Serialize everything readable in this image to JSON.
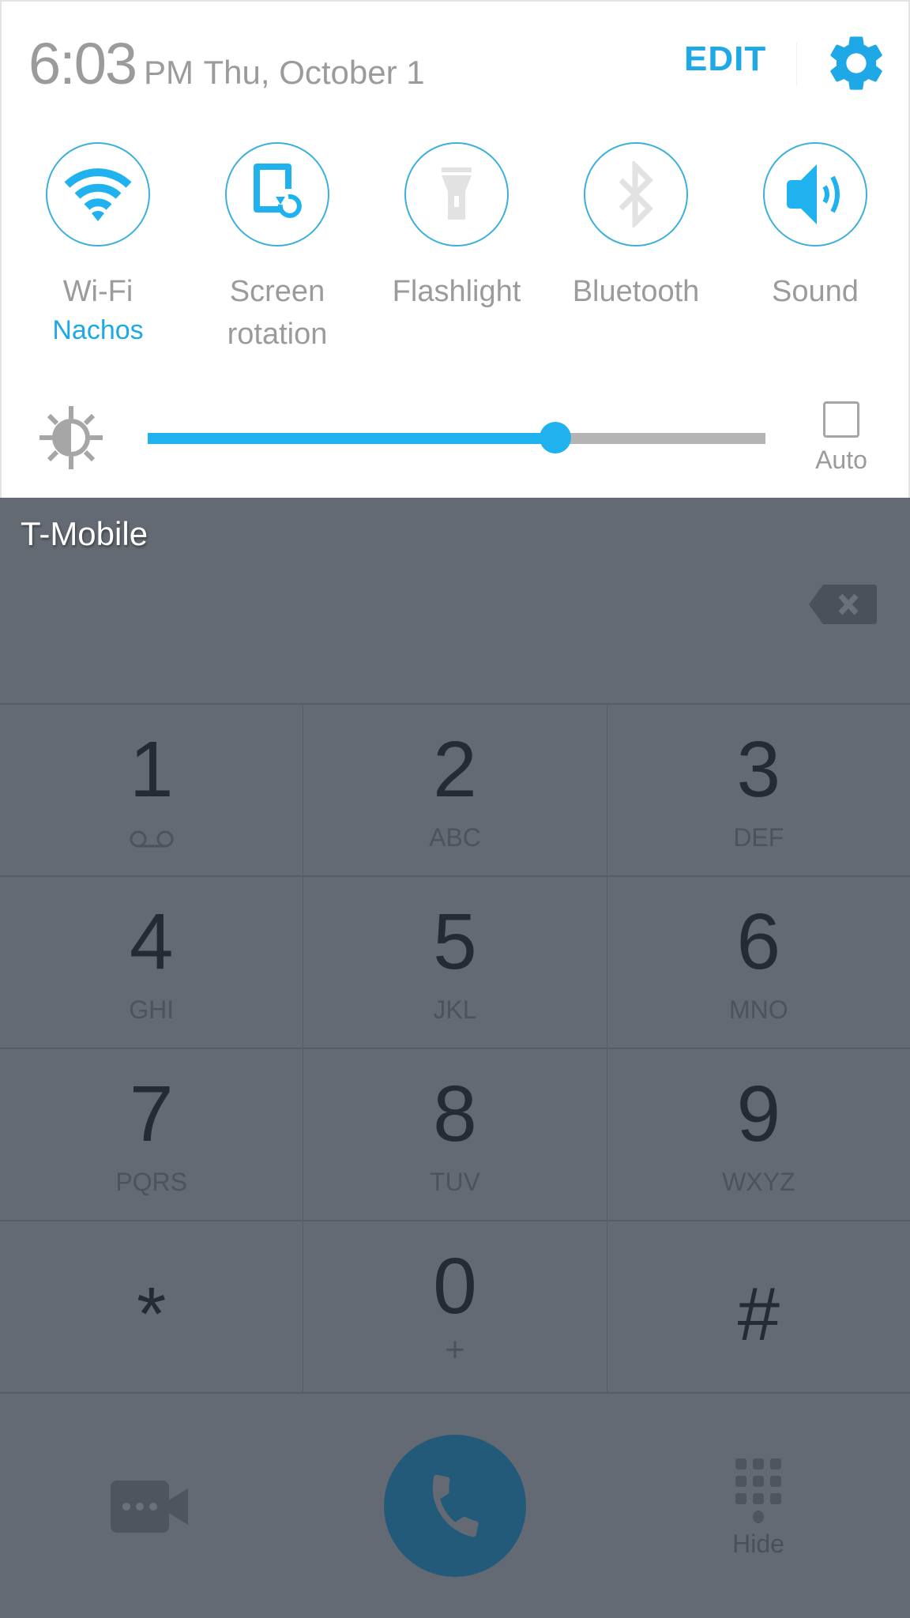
{
  "status": {
    "time": "6:03",
    "ampm": "PM",
    "date": "Thu, October 1"
  },
  "header": {
    "edit_label": "EDIT",
    "settings_icon": "gear-icon"
  },
  "quick_toggles": [
    {
      "id": "wifi",
      "label": "Wi-Fi",
      "sublabel": "Nachos",
      "icon": "wifi-icon",
      "state": "on"
    },
    {
      "id": "screen-rotation",
      "label": "Screen rotation",
      "label_lines": [
        "Screen",
        "rotation"
      ],
      "icon": "screen-rotation-icon",
      "state": "on"
    },
    {
      "id": "flashlight",
      "label": "Flashlight",
      "icon": "flashlight-icon",
      "state": "off"
    },
    {
      "id": "bluetooth",
      "label": "Bluetooth",
      "icon": "bluetooth-icon",
      "state": "off"
    },
    {
      "id": "sound",
      "label": "Sound",
      "icon": "sound-icon",
      "state": "on"
    }
  ],
  "brightness": {
    "icon": "brightness-icon",
    "level_percent": 66,
    "auto_label": "Auto",
    "auto_checked": false
  },
  "dialer": {
    "carrier": "T-Mobile",
    "number": "",
    "backspace_icon": "backspace-icon",
    "keys": [
      [
        {
          "digit": "1",
          "letters": "",
          "icon": "voicemail-icon"
        },
        {
          "digit": "2",
          "letters": "ABC"
        },
        {
          "digit": "3",
          "letters": "DEF"
        }
      ],
      [
        {
          "digit": "4",
          "letters": "GHI"
        },
        {
          "digit": "5",
          "letters": "JKL"
        },
        {
          "digit": "6",
          "letters": "MNO"
        }
      ],
      [
        {
          "digit": "7",
          "letters": "PQRS"
        },
        {
          "digit": "8",
          "letters": "TUV"
        },
        {
          "digit": "9",
          "letters": "WXYZ"
        }
      ],
      [
        {
          "digit": "*",
          "letters": ""
        },
        {
          "digit": "0",
          "letters": "+"
        },
        {
          "digit": "#",
          "letters": ""
        }
      ]
    ],
    "bottom": {
      "video_call_icon": "video-call-icon",
      "call_icon": "phone-icon",
      "hide_label": "Hide",
      "hide_icon": "dialpad-icon"
    }
  },
  "colors": {
    "accent": "#1fa8e6",
    "panel_bg": "#ffffff",
    "dimmed_bg": "#636a73",
    "call_button": "#245a79",
    "inactive_icon": "#e0e0e0"
  }
}
